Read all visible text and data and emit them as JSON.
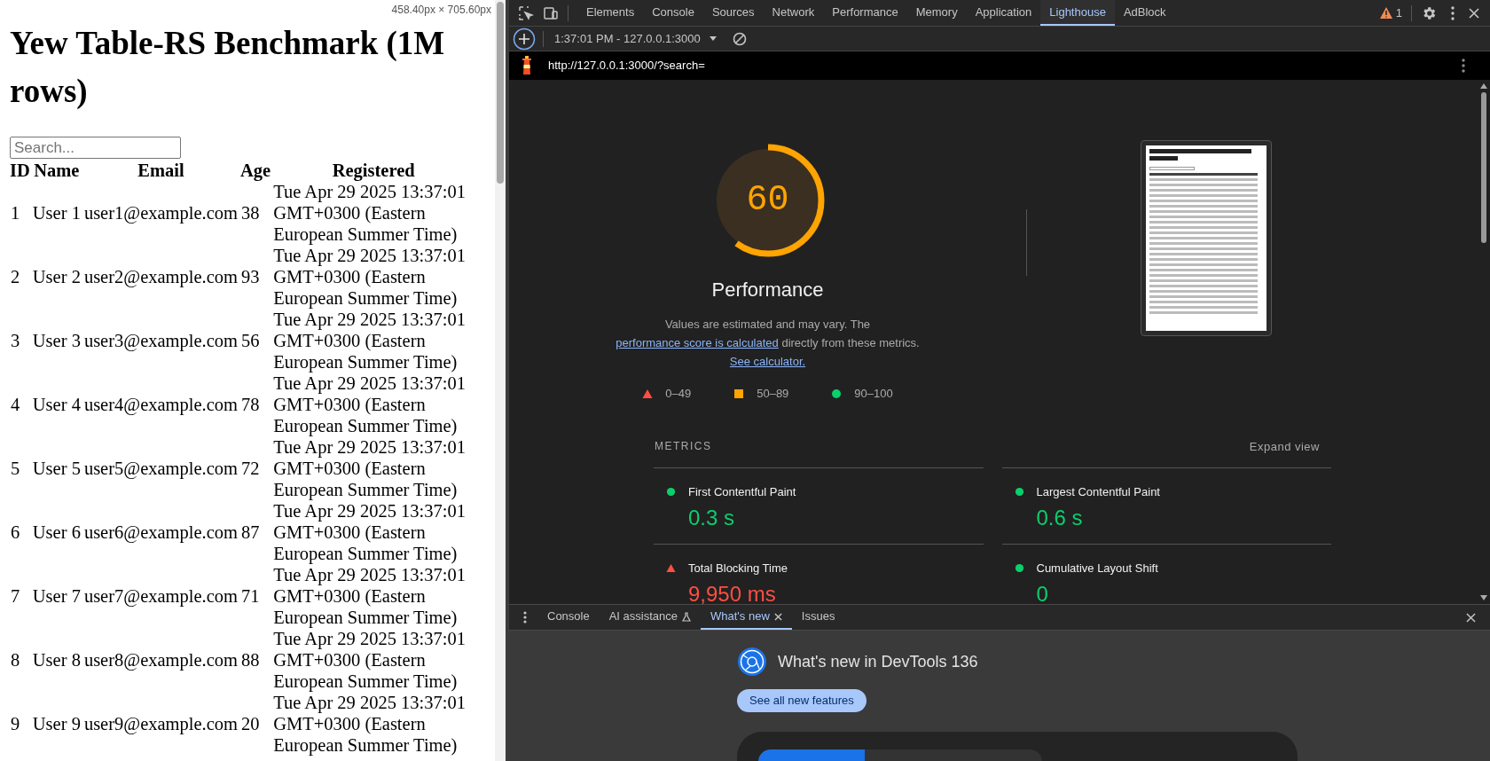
{
  "page": {
    "dimension_badge": "458.40px × 705.60px",
    "title": "Yew Table-RS Benchmark (1M rows)",
    "search": {
      "placeholder": "Search..."
    },
    "table": {
      "columns": [
        "ID",
        "Name",
        "Email",
        "Age",
        "Registered"
      ],
      "rows": [
        [
          "1",
          "User 1",
          "user1@example.com",
          "38",
          "Tue Apr 29 2025 13:37:01 GMT+0300 (Eastern European Summer Time)"
        ],
        [
          "2",
          "User 2",
          "user2@example.com",
          "93",
          "Tue Apr 29 2025 13:37:01 GMT+0300 (Eastern European Summer Time)"
        ],
        [
          "3",
          "User 3",
          "user3@example.com",
          "56",
          "Tue Apr 29 2025 13:37:01 GMT+0300 (Eastern European Summer Time)"
        ],
        [
          "4",
          "User 4",
          "user4@example.com",
          "78",
          "Tue Apr 29 2025 13:37:01 GMT+0300 (Eastern European Summer Time)"
        ],
        [
          "5",
          "User 5",
          "user5@example.com",
          "72",
          "Tue Apr 29 2025 13:37:01 GMT+0300 (Eastern European Summer Time)"
        ],
        [
          "6",
          "User 6",
          "user6@example.com",
          "87",
          "Tue Apr 29 2025 13:37:01 GMT+0300 (Eastern European Summer Time)"
        ],
        [
          "7",
          "User 7",
          "user7@example.com",
          "71",
          "Tue Apr 29 2025 13:37:01 GMT+0300 (Eastern European Summer Time)"
        ],
        [
          "8",
          "User 8",
          "user8@example.com",
          "88",
          "Tue Apr 29 2025 13:37:01 GMT+0300 (Eastern European Summer Time)"
        ],
        [
          "9",
          "User 9",
          "user9@example.com",
          "20",
          "Tue Apr 29 2025 13:37:01 GMT+0300 (Eastern European Summer Time)"
        ]
      ]
    }
  },
  "devtools": {
    "tabs": [
      {
        "label": "Elements",
        "selected": false
      },
      {
        "label": "Console",
        "selected": false
      },
      {
        "label": "Sources",
        "selected": false
      },
      {
        "label": "Network",
        "selected": false
      },
      {
        "label": "Performance",
        "selected": false
      },
      {
        "label": "Memory",
        "selected": false
      },
      {
        "label": "Application",
        "selected": false
      },
      {
        "label": "Lighthouse",
        "selected": true
      },
      {
        "label": "AdBlock",
        "selected": false
      }
    ],
    "warning_count": "1",
    "report_select": "1:37:01 PM - 127.0.0.1:3000",
    "url": "http://127.0.0.1:3000/?search=",
    "score": {
      "value": "60",
      "level": 0.6,
      "kind": "average",
      "label": "Performance"
    },
    "description": [
      {
        "kind": "text",
        "text": "Values are estimated and may vary. The "
      },
      {
        "kind": "link",
        "text": "performance score is calculated"
      },
      {
        "kind": "text",
        "text": " directly from these metrics. "
      },
      {
        "kind": "link",
        "text": "See calculator."
      }
    ],
    "legend": [
      {
        "kind": "fail",
        "label": "0–49"
      },
      {
        "kind": "average",
        "label": "50–89"
      },
      {
        "kind": "pass",
        "label": "90–100"
      }
    ],
    "metrics_heading": "METRICS",
    "expand_view": "Expand view",
    "metrics": [
      {
        "kind": "pass",
        "name": "First Contentful Paint",
        "value": "0.3 s"
      },
      {
        "kind": "pass",
        "name": "Largest Contentful Paint",
        "value": "0.6 s"
      },
      {
        "kind": "fail",
        "name": "Total Blocking Time",
        "value": "9,950 ms"
      },
      {
        "kind": "pass",
        "name": "Cumulative Layout Shift",
        "value": "0"
      }
    ],
    "drawer_tabs": [
      {
        "label": "Console",
        "selected": false,
        "experimental": false,
        "closable": false
      },
      {
        "label": "AI assistance",
        "selected": false,
        "experimental": true,
        "closable": false
      },
      {
        "label": "What's new",
        "selected": true,
        "experimental": false,
        "closable": true
      },
      {
        "label": "Issues",
        "selected": false,
        "experimental": false,
        "closable": false
      }
    ],
    "whats_new": {
      "title": "What's new in DevTools 136",
      "button": "See all new features"
    }
  }
}
